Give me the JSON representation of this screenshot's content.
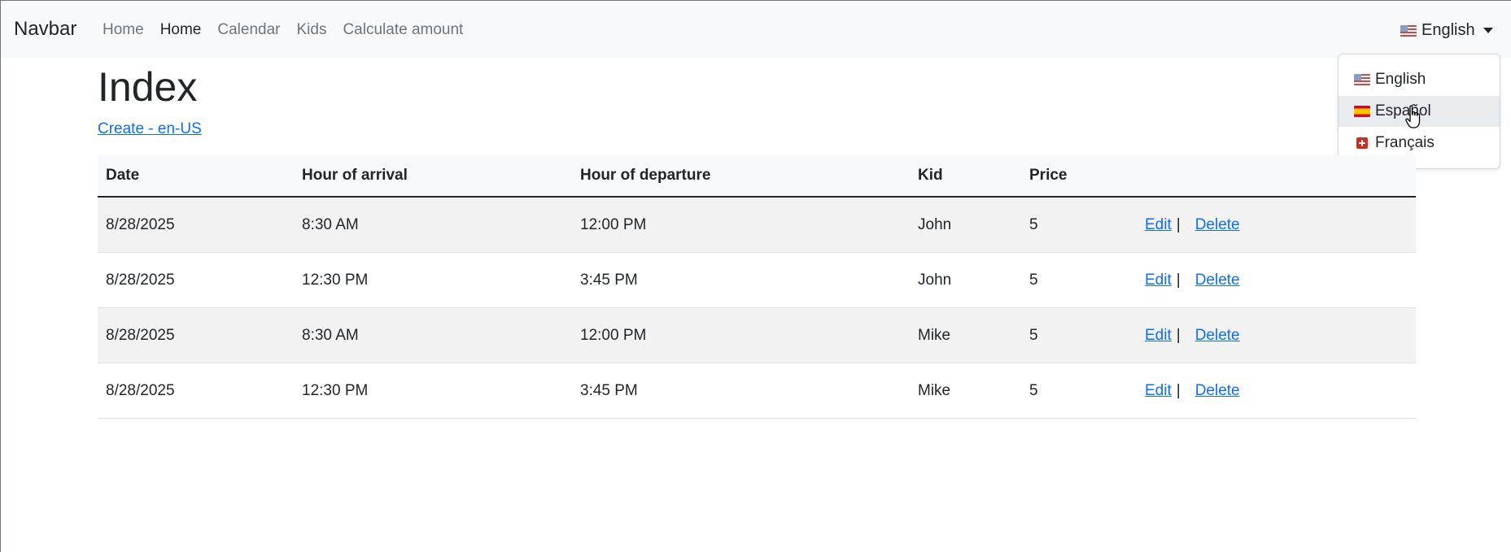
{
  "navbar": {
    "brand": "Navbar",
    "links": [
      "Home",
      "Home",
      "Calendar",
      "Kids",
      "Calculate amount"
    ],
    "language": "English"
  },
  "dropdown": {
    "items": [
      {
        "label": "English",
        "flag": "us-flag-icon"
      },
      {
        "label": "Español",
        "flag": "es-flag-icon"
      },
      {
        "label": "Français",
        "flag": "ch-flag-icon"
      }
    ],
    "hovered_index": 1
  },
  "page": {
    "title": "Index",
    "create_link": "Create - en-US"
  },
  "table": {
    "headers": [
      "Date",
      "Hour of arrival",
      "Hour of departure",
      "Kid",
      "Price",
      ""
    ],
    "rows": [
      {
        "date": "8/28/2025",
        "arrival": "8:30 AM",
        "departure": "12:00 PM",
        "kid": "John",
        "price": "5"
      },
      {
        "date": "8/28/2025",
        "arrival": "12:30 PM",
        "departure": "3:45 PM",
        "kid": "John",
        "price": "5"
      },
      {
        "date": "8/28/2025",
        "arrival": "8:30 AM",
        "departure": "12:00 PM",
        "kid": "Mike",
        "price": "5"
      },
      {
        "date": "8/28/2025",
        "arrival": "12:30 PM",
        "departure": "3:45 PM",
        "kid": "Mike",
        "price": "5"
      }
    ],
    "edit_label": "Edit",
    "separator": "|",
    "delete_label": "Delete"
  },
  "colors": {
    "link": "#0d6efd",
    "navbar_bg": "#f8f9fa",
    "striped_row": "#f2f2f2"
  }
}
